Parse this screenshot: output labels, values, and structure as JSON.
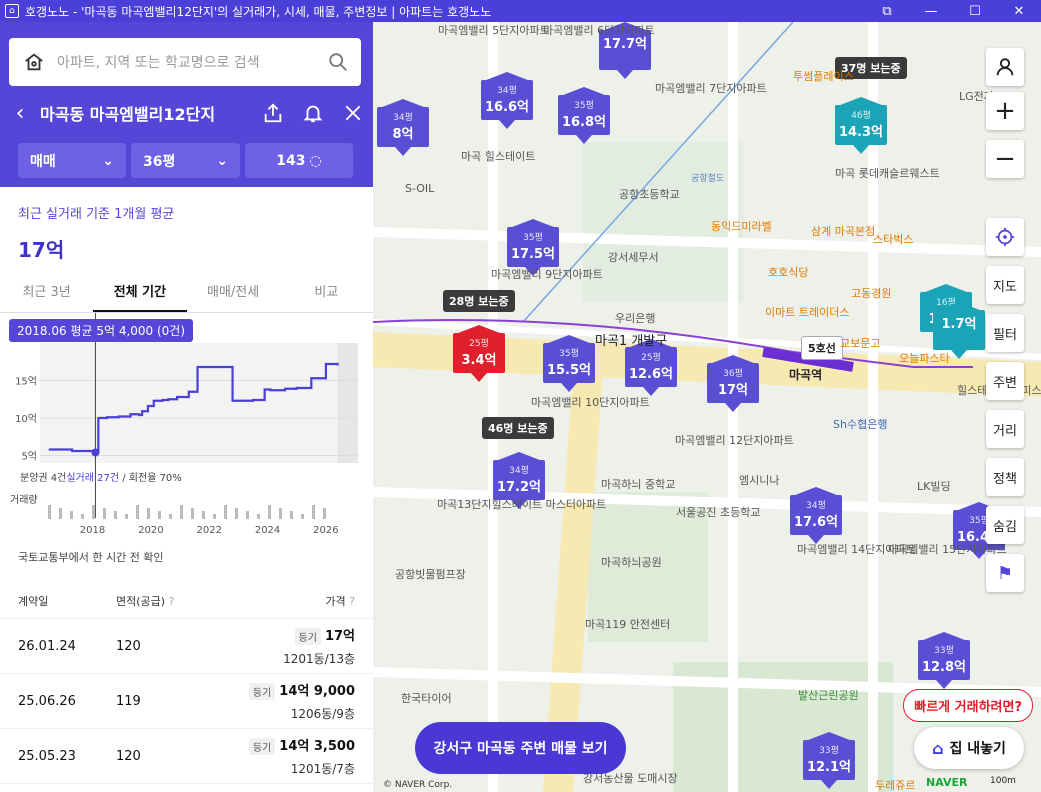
{
  "window": {
    "title": "호갱노노 - '마곡동 마곡엠밸리12단지'의 실거래가, 시세, 매물, 주변정보 | 아파트는 호갱노노"
  },
  "search": {
    "placeholder": "아파트, 지역 또는 학교명으로 검색"
  },
  "header": {
    "name": "마곡동 마곡엠밸리12단지"
  },
  "filters": {
    "type": "매매",
    "size": "36평",
    "count": "143"
  },
  "summary": {
    "label": "최근 실거래 기준 1개월 평균",
    "price": "17억"
  },
  "tabs": [
    "최근 3년",
    "전체 기간",
    "매매/전세",
    "비교"
  ],
  "chart_data": {
    "type": "line",
    "tooltip": "2018.06 평균 5억 4,000 (0건)",
    "y_ticks": [
      "5억",
      "10억",
      "15억"
    ],
    "x_ticks": [
      "2018",
      "2020",
      "2022",
      "2024",
      "2026"
    ],
    "note_prefix": "분양권 4건",
    "note_highlight": "실거래 27건",
    "note_suffix": " / 회전율 70%",
    "volume_label": "거래량",
    "x": [
      2016.5,
      2017.3,
      2017.5,
      2018.1,
      2018.2,
      2018.5,
      2018.9,
      2019.3,
      2019.6,
      2019.7,
      2019.9,
      2020.1,
      2020.4,
      2020.6,
      2020.9,
      2021.3,
      2021.6,
      2022.5,
      2022.8,
      2023.5,
      2023.9,
      2024.1,
      2024.6,
      2025.0,
      2025.5,
      2026.0,
      2026.4
    ],
    "y": [
      5.8,
      5.6,
      5.6,
      5.4,
      10.0,
      10.1,
      10.2,
      10.5,
      10.4,
      10.9,
      11.6,
      12.3,
      12.4,
      12.5,
      12.8,
      13.5,
      16.8,
      16.8,
      12.3,
      12.4,
      13.8,
      13.7,
      13.9,
      14.0,
      15.3,
      17.2,
      17.0
    ],
    "ylim": [
      4,
      20
    ],
    "xlim": [
      2016.2,
      2027.1
    ]
  },
  "table": {
    "source": "국토교통부에서 한 시간 전 확인",
    "headers": [
      "계약일",
      "면적(공급)",
      "가격"
    ],
    "rows": [
      {
        "date": "26.01.24",
        "area": "120",
        "tag": "등기",
        "price": "17억",
        "floor": "1201동/13층"
      },
      {
        "date": "25.06.26",
        "area": "119",
        "tag": "등기",
        "price": "14억 9,000",
        "floor": "1206동/9층"
      },
      {
        "date": "25.05.23",
        "area": "120",
        "tag": "등기",
        "price": "14억 3,500",
        "floor": "1201동/7층"
      }
    ]
  },
  "map": {
    "markers": [
      {
        "area": "",
        "price": "17.7억",
        "kind": "purple"
      },
      {
        "area": "34평",
        "price": "16.6억",
        "kind": "purple"
      },
      {
        "area": "35평",
        "price": "16.8억",
        "kind": "purple"
      },
      {
        "area": "34평",
        "price": "8억",
        "kind": "purple"
      },
      {
        "area": "46평",
        "price": "14.3억",
        "kind": "teal"
      },
      {
        "area": "35평",
        "price": "17.5억",
        "kind": "purple"
      },
      {
        "area": "25평",
        "price": "3.4억",
        "kind": "red"
      },
      {
        "area": "35평",
        "price": "15.5억",
        "kind": "purple"
      },
      {
        "area": "25평",
        "price": "12.6억",
        "kind": "purple"
      },
      {
        "area": "36평",
        "price": "17억",
        "kind": "purple"
      },
      {
        "area": "34평",
        "price": "17.2억",
        "kind": "purple"
      },
      {
        "area": "34평",
        "price": "17.6억",
        "kind": "purple"
      },
      {
        "area": "16평",
        "price": "1.7억",
        "kind": "teal"
      },
      {
        "area": "",
        "price": "1.7억",
        "kind": "teal"
      },
      {
        "area": "35평",
        "price": "16.4억",
        "kind": "purple"
      },
      {
        "area": "33평",
        "price": "12.8억",
        "kind": "purple"
      },
      {
        "area": "33평",
        "price": "12.1억",
        "kind": "purple"
      }
    ],
    "pills": [
      "37명 보는중",
      "28명 보는중",
      "46명 보는중",
      "5호선",
      "공항철도"
    ],
    "labels": [
      "마곡엠밸리 5단지아파트",
      "마곡엠밸리 6단지아파트",
      "마곡엠밸리 7단지아파트",
      "마곡 힐스테이트",
      "마곡 롯데캐슬르웨스트",
      "공항초등학교",
      "동익드미라벨",
      "삼계 마곡본점",
      "스타벅스",
      "호호식당",
      "고동경원",
      "마곡엠밸리 9단지아파트",
      "강서세무서",
      "우리은행",
      "이마트 트레이더스",
      "교보문고",
      "마곡1 개발구",
      "마곡엠밸리 10단지아파트",
      "마곡역",
      "오늘파스타",
      "Sh수협은행",
      "힐스테이트 오피스텔",
      "마곡엠밸리 12단지아파트",
      "마곡하늬 중학교",
      "서울공진 초등학교",
      "마곡13단지힐스테이트 마스터아파트",
      "엠시니나",
      "LK빌딩",
      "마곡엠밸리 14단지아파트",
      "마곡엠밸리 15단지아파트",
      "마곡하늬공원",
      "공항빗물펌프장",
      "마곡119 안전센터",
      "한국타이어",
      "발산근린공원",
      "강서농산물 도매시장",
      "두레쥬르",
      "투썸플레이스",
      "S-OIL",
      "LG전자"
    ],
    "controls": [
      "지도",
      "필터",
      "주변",
      "거리",
      "정책",
      "숨김"
    ],
    "bottom_button": "강서구 마곡동 주변 매물 보기",
    "bubble": "빠르게 거래하려면?",
    "list_button": "집 내놓기",
    "copyright": "© NAVER Corp.",
    "scale": "100m",
    "naver": "NAVER"
  },
  "colors": {
    "brand": "#5646d8",
    "red": "#e0202c",
    "teal": "#1ba4b8"
  }
}
